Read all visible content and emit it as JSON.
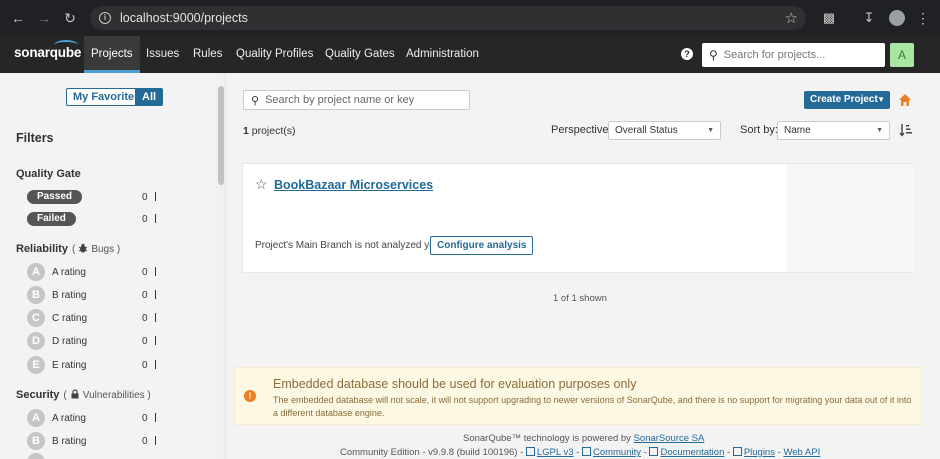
{
  "browser": {
    "url": "localhost:9000/projects"
  },
  "navbar": {
    "logo": "sonarqube",
    "items": [
      {
        "label": "Projects",
        "active": true
      },
      {
        "label": "Issues"
      },
      {
        "label": "Rules"
      },
      {
        "label": "Quality Profiles"
      },
      {
        "label": "Quality Gates"
      },
      {
        "label": "Administration"
      }
    ],
    "search_placeholder": "Search for projects...",
    "avatar": "A"
  },
  "sidebar": {
    "toggle_favorites": "My Favorites",
    "toggle_all": "All",
    "filters_title": "Filters",
    "quality_gate": {
      "title": "Quality Gate",
      "items": [
        {
          "label": "Passed",
          "count": "0"
        },
        {
          "label": "Failed",
          "count": "0"
        }
      ]
    },
    "reliability": {
      "title": "Reliability",
      "subtitle": "Bugs",
      "items": [
        {
          "badge": "A",
          "label": "A rating",
          "count": "0"
        },
        {
          "badge": "B",
          "label": "B rating",
          "count": "0"
        },
        {
          "badge": "C",
          "label": "C rating",
          "count": "0"
        },
        {
          "badge": "D",
          "label": "D rating",
          "count": "0"
        },
        {
          "badge": "E",
          "label": "E rating",
          "count": "0"
        }
      ]
    },
    "security": {
      "title": "Security",
      "subtitle": "Vulnerabilities",
      "items": [
        {
          "badge": "A",
          "label": "A rating",
          "count": "0"
        },
        {
          "badge": "B",
          "label": "B rating",
          "count": "0"
        }
      ]
    }
  },
  "main": {
    "search_placeholder": "Search by project name or key",
    "create_project": "Create Project",
    "project_count": "1",
    "project_count_suffix": " project(s)",
    "perspective_label": "Perspective:",
    "perspective_value": "Overall Status",
    "sort_label": "Sort by:",
    "sort_value": "Name",
    "project": {
      "name": "BookBazaar Microservices",
      "status": "Project's Main Branch is not analyzed yet.",
      "configure_button": "Configure analysis"
    },
    "shown": "1 of 1 shown"
  },
  "warning": {
    "title": "Embedded database should be used for evaluation purposes only",
    "text": "The embedded database will not scale, it will not support upgrading to newer versions of SonarQube, and there is no support for migrating your data out of it into a different database engine."
  },
  "footer": {
    "powered_prefix": "SonarQube™ technology is powered by ",
    "powered_link": "SonarSource SA",
    "edition": "Community Edition - v9.9.8 (build 100196) - ",
    "links": [
      "LGPL v3",
      "Community",
      "Documentation",
      "Plugins",
      "Web API"
    ],
    "separator": " - "
  },
  "colors": {
    "accent": "#236a97",
    "navbar": "#262626",
    "nav_highlight": "#4b9fd5",
    "warning_bg": "#fcf8e3"
  }
}
